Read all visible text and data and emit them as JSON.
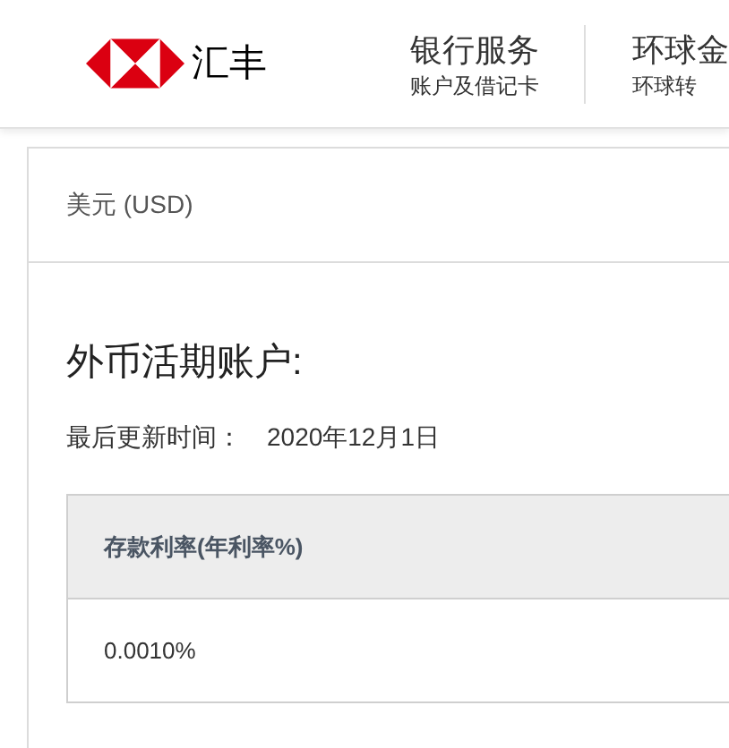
{
  "header": {
    "brand": "汇丰",
    "nav": [
      {
        "title": "银行服务",
        "subtitle": "账户及借记卡"
      },
      {
        "title": "环球金",
        "subtitle": "环球转"
      }
    ]
  },
  "currency": "美元 (USD)",
  "section_title": "外币活期账户:",
  "updated": {
    "label": "最后更新时间：",
    "value": "2020年12月1日"
  },
  "table": {
    "columns": [
      "存款利率(年利率%)"
    ],
    "rows": [
      [
        "0.0010%"
      ]
    ]
  }
}
